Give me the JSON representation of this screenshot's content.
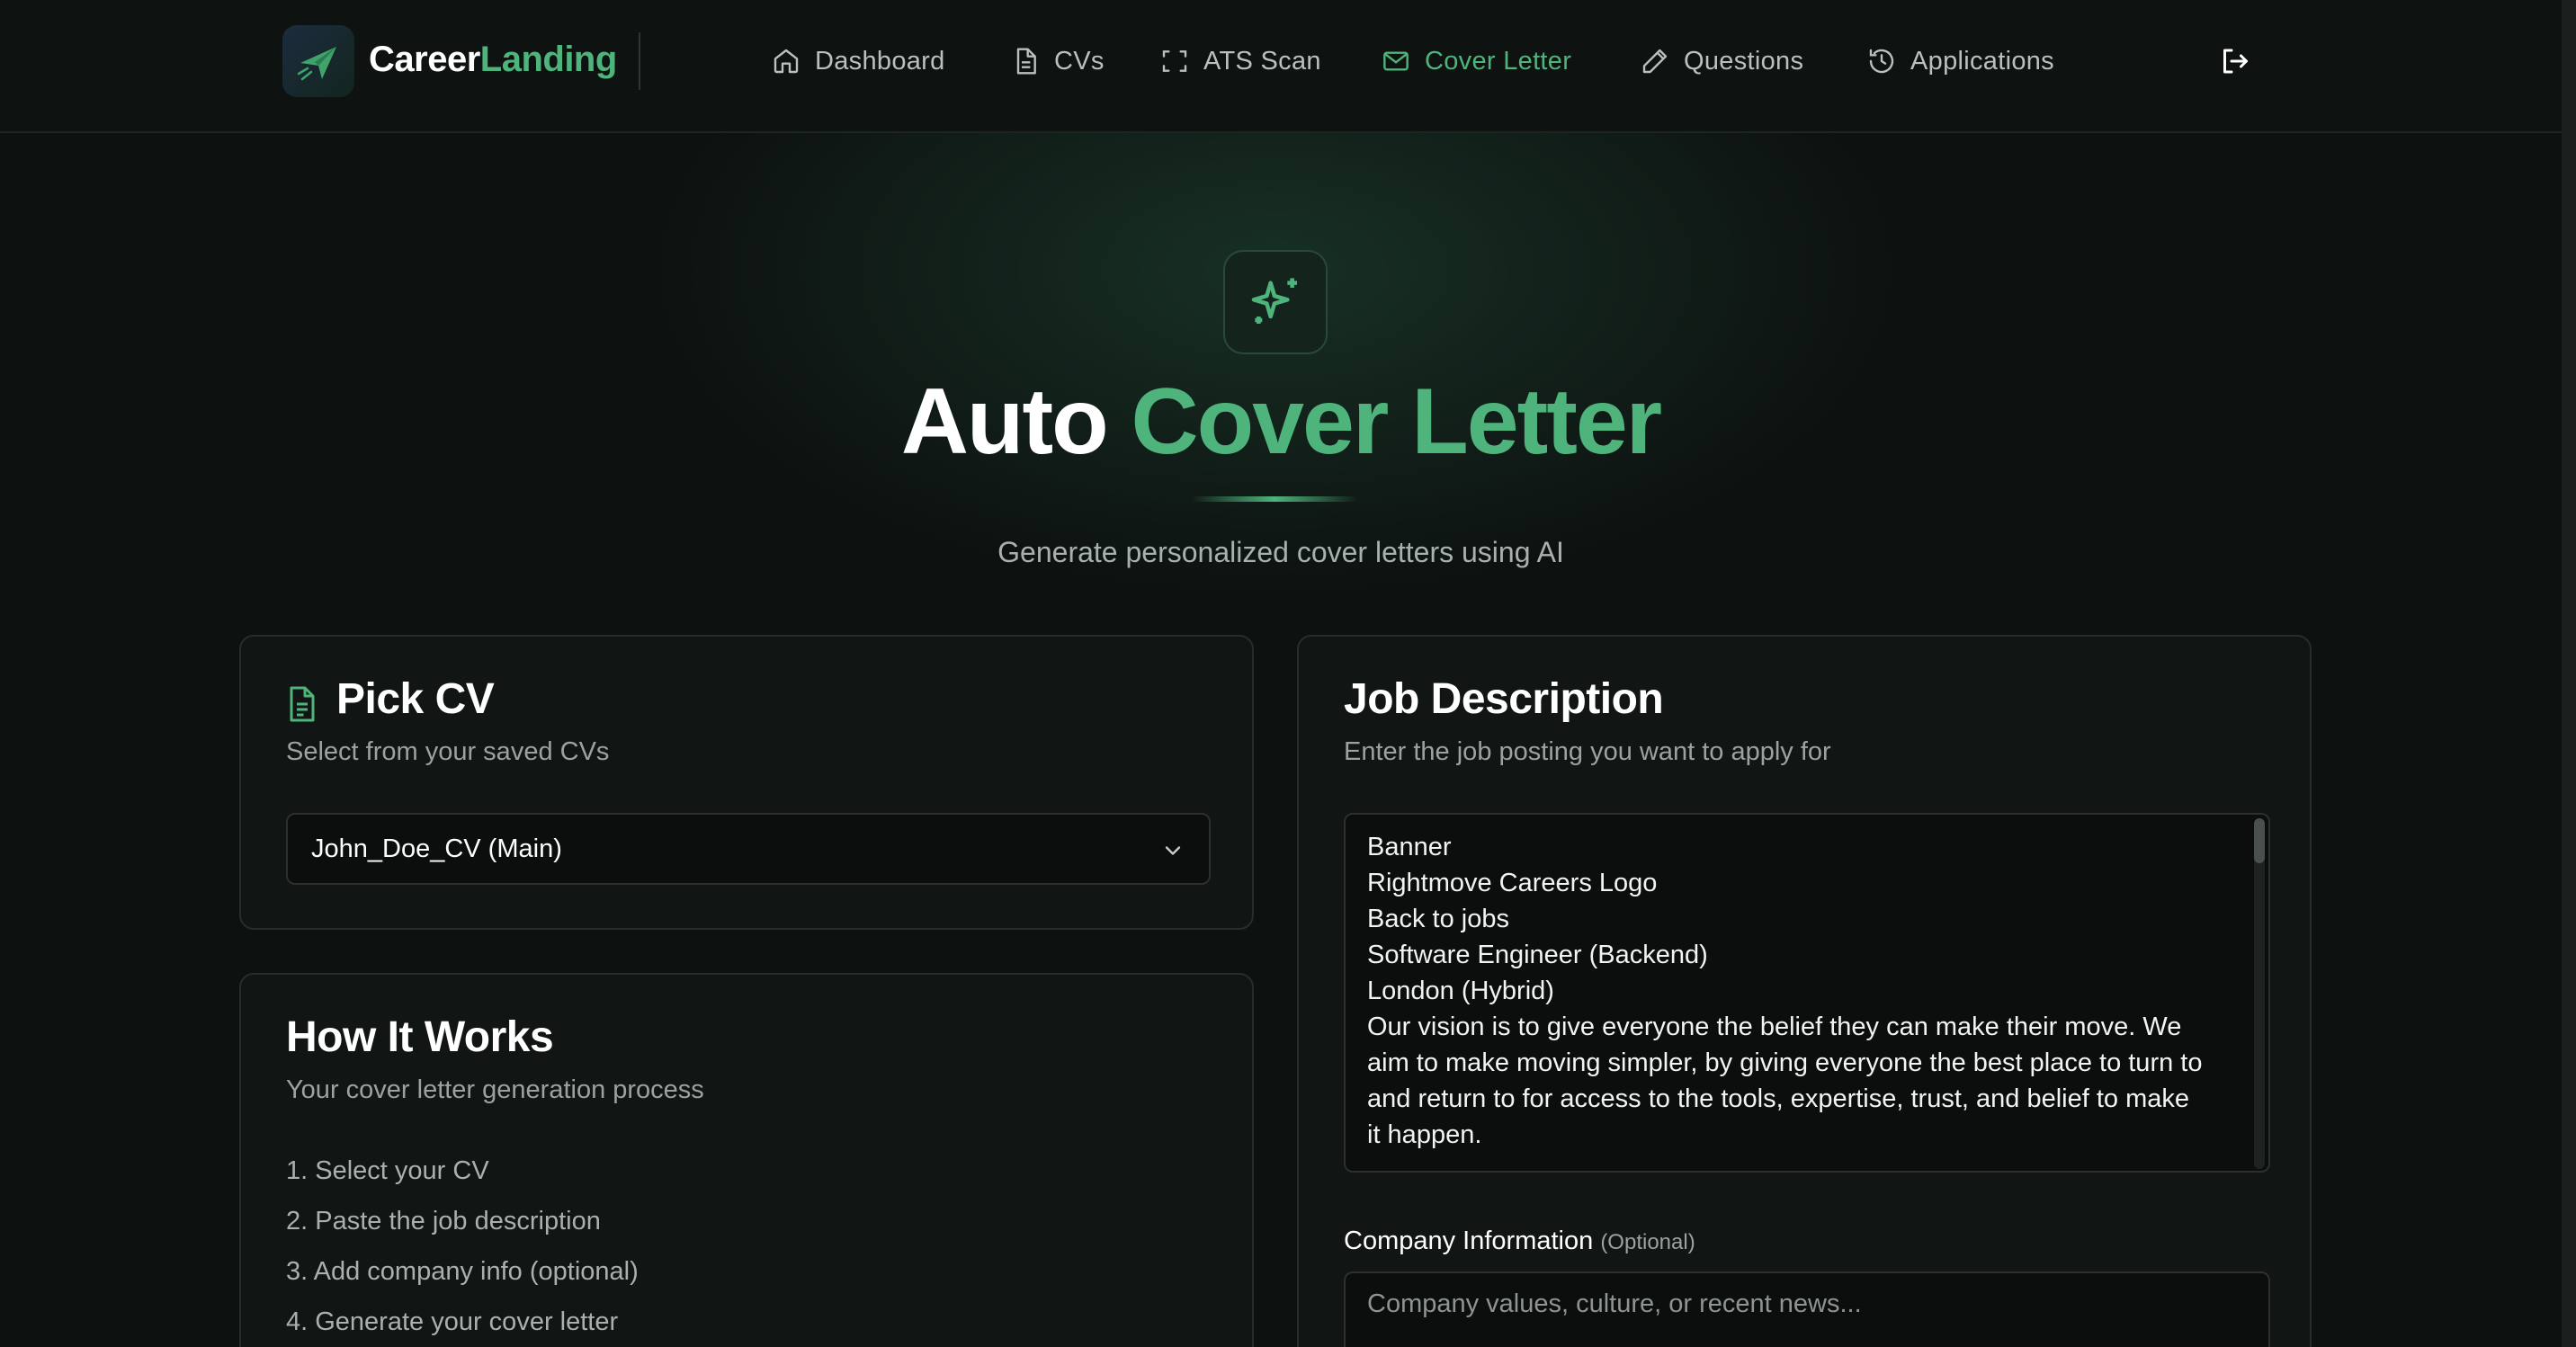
{
  "brand": {
    "part1": "Career",
    "part2": "Landing"
  },
  "nav": {
    "items": [
      {
        "label": "Dashboard",
        "icon": "home-icon"
      },
      {
        "label": "CVs",
        "icon": "document-icon"
      },
      {
        "label": "ATS Scan",
        "icon": "scan-icon"
      },
      {
        "label": "Cover Letter",
        "icon": "mail-icon",
        "active": true
      },
      {
        "label": "Questions",
        "icon": "pencil-icon"
      },
      {
        "label": "Applications",
        "icon": "history-icon"
      }
    ],
    "logout_icon": "logout-icon"
  },
  "hero": {
    "icon": "sparkles-icon",
    "title_part1": "Auto",
    "title_part2": "Cover Letter",
    "subtitle": "Generate personalized cover letters using AI"
  },
  "pick_cv": {
    "title": "Pick CV",
    "subtitle": "Select from your saved CVs",
    "selected": "John_Doe_CV (Main)"
  },
  "how_it_works": {
    "title": "How It Works",
    "subtitle": "Your cover letter generation process",
    "steps": [
      "1. Select your CV",
      "2. Paste the job description",
      "3. Add company info (optional)",
      "4. Generate your cover letter"
    ]
  },
  "job_description": {
    "title": "Job Description",
    "subtitle": "Enter the job posting you want to apply for",
    "lines": [
      "Banner",
      "Rightmove Careers Logo",
      "Back to jobs",
      "Software Engineer (Backend)",
      "London (Hybrid)",
      "Our vision is to give everyone the belief they can make their move. We",
      "aim to make moving simpler, by giving everyone the best place to turn to",
      "and return to for access to the tools, expertise, trust, and belief to make",
      "it happen."
    ],
    "company_label": "Company Information",
    "company_optional": "(Optional)",
    "company_placeholder": "Company values, culture, or recent news..."
  },
  "colors": {
    "accent": "#4fb37c",
    "background": "#0d1110",
    "card": "#111514"
  }
}
